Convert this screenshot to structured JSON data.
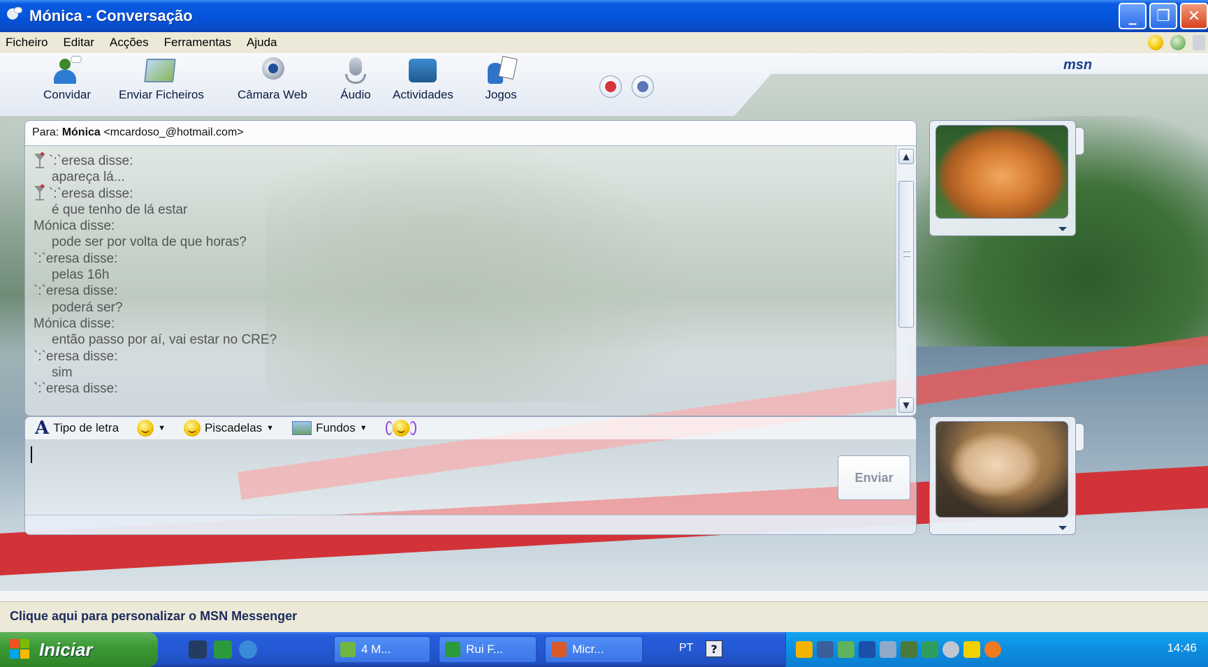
{
  "window": {
    "title": "Mónica - Conversação",
    "controls": {
      "minimize": "_",
      "maximize": "❐",
      "close": "✕"
    }
  },
  "menu": {
    "items": [
      "Ficheiro",
      "Editar",
      "Acções",
      "Ferramentas",
      "Ajuda"
    ]
  },
  "toolbar": {
    "items": [
      {
        "label": "Convidar",
        "icon": "invite-icon"
      },
      {
        "label": "Enviar Ficheiros",
        "icon": "send-files-icon"
      },
      {
        "label": "Câmara Web",
        "icon": "webcam-icon"
      },
      {
        "label": "Áudio",
        "icon": "audio-icon"
      },
      {
        "label": "Actividades",
        "icon": "activities-icon"
      },
      {
        "label": "Jogos",
        "icon": "games-icon"
      }
    ],
    "brand": "msn"
  },
  "conversation": {
    "to_label": "Para:",
    "to_name": "Mónica",
    "to_email": "<mcardoso_@hotmail.com>",
    "messages": [
      {
        "sender": "`:`eresa disse:",
        "text": "apareça lá..."
      },
      {
        "sender": "`:`eresa disse:",
        "text": "é que tenho de lá estar"
      },
      {
        "sender": "Mónica disse:",
        "text": "pode ser por volta de que horas?"
      },
      {
        "sender": "`:`eresa disse:",
        "text": "pelas 16h"
      },
      {
        "sender": "`:`eresa disse:",
        "text": "poderá ser?"
      },
      {
        "sender": "Mónica disse:",
        "text": "então passo por aí, vai estar no CRE?"
      },
      {
        "sender": "`:`eresa disse:",
        "text": "sim"
      },
      {
        "sender": "`:`eresa disse:",
        "text": ""
      }
    ]
  },
  "compose": {
    "font_label": "Tipo de letra",
    "winks_label": "Piscadelas",
    "backgrounds_label": "Fundos",
    "send_label": "Enviar",
    "input_value": ""
  },
  "status": {
    "text": "Clique aqui para personalizar o MSN Messenger"
  },
  "taskbar": {
    "start_label": "Iniciar",
    "tasks": [
      {
        "label": "4 M...",
        "icon": "msn-people-icon"
      },
      {
        "label": "Rui F...",
        "icon": "msn-window-icon"
      },
      {
        "label": "Micr...",
        "icon": "powerpoint-icon"
      }
    ],
    "lang": "PT",
    "clock": "14:46"
  },
  "colors": {
    "titlebar": "#0454dd",
    "taskbar": "#2558d4",
    "start_button": "#3d9a36",
    "tray": "#0d8ddf"
  }
}
